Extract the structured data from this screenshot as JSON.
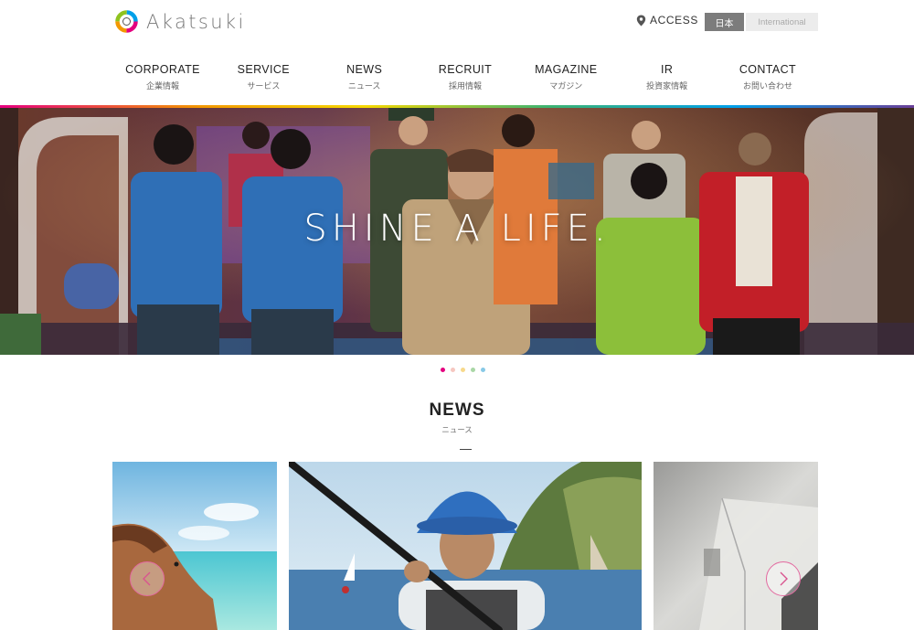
{
  "brand": {
    "name": "Akatsuki"
  },
  "header": {
    "access_label": "ACCESS",
    "lang_ja": "日本",
    "lang_intl": "International"
  },
  "nav": [
    {
      "en": "CORPORATE",
      "ja": "企業情報"
    },
    {
      "en": "SERVICE",
      "ja": "サービス"
    },
    {
      "en": "NEWS",
      "ja": "ニュース"
    },
    {
      "en": "RECRUIT",
      "ja": "採用情報"
    },
    {
      "en": "MAGAZINE",
      "ja": "マガジン"
    },
    {
      "en": "IR",
      "ja": "投資家情報"
    },
    {
      "en": "CONTACT",
      "ja": "お問い合わせ"
    }
  ],
  "hero": {
    "title": "SHINE A LIFE."
  },
  "slider": {
    "dot_colors": [
      "#e4007f",
      "#f6c7c0",
      "#f7d98b",
      "#a9d7a6",
      "#88c9e6"
    ],
    "active_index": 0
  },
  "news": {
    "title": "NEWS",
    "subtitle": "ニュース"
  },
  "icons": {
    "access": "map-pin-icon",
    "prev": "chevron-left-icon",
    "next": "chevron-right-icon"
  },
  "colors": {
    "accent": "#e36aa0",
    "lang_active_bg": "#7c7c7c"
  }
}
